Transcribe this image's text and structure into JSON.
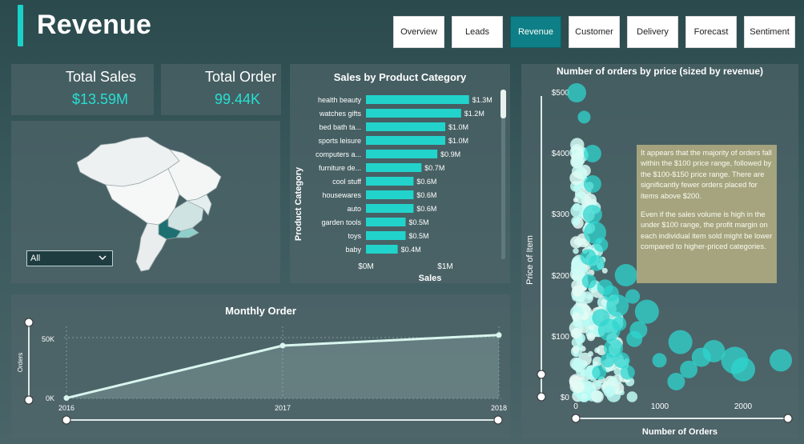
{
  "page": {
    "title": "Revenue"
  },
  "nav": [
    {
      "label": "Overview",
      "active": false
    },
    {
      "label": "Leads",
      "active": false
    },
    {
      "label": "Revenue",
      "active": true
    },
    {
      "label": "Customer",
      "active": false
    },
    {
      "label": "Delivery",
      "active": false
    },
    {
      "label": "Forecast",
      "active": false
    },
    {
      "label": "Sentiment",
      "active": false
    }
  ],
  "kpis": {
    "total_sales": {
      "label": "Total Sales",
      "value": "$13.59M"
    },
    "total_order": {
      "label": "Total Order",
      "value": "99.44K"
    }
  },
  "map": {
    "filter_value": "All"
  },
  "category_chart": {
    "title": "Sales by Product Category",
    "ylabel": "Product Category",
    "xlabel": "Sales",
    "xticks": [
      "$0M",
      "$1M"
    ]
  },
  "monthly_chart": {
    "title": "Monthly Order",
    "ylabel": "Orders",
    "yticks": [
      "50K",
      "0K"
    ],
    "xticks": [
      "2016",
      "2017",
      "2018"
    ]
  },
  "scatter_chart": {
    "title": "Number of orders by price (sized by revenue)",
    "ylabel": "Price of Item",
    "xlabel": "Number of Orders",
    "yticks": [
      "$500",
      "$400",
      "$300",
      "$200",
      "$100",
      "$0"
    ],
    "xticks": [
      "0",
      "1000",
      "2000"
    ],
    "note_p1": " It appears that the majority of orders fall within the $100 price range, followed by the $100-$150 price range. There are significantly fewer orders placed for items above $200.",
    "note_p2": "Even if the sales volume is high in the under $100 range, the profit margin on each individual item sold might be lower compared to higher-priced categories."
  },
  "colors": {
    "accent": "#19d2c7",
    "bar": "#22d3cc",
    "nav_active": "#0e7f86",
    "line": "#d9f5ee",
    "note_bg": "#b2ad82"
  },
  "chart_data": [
    {
      "type": "bar",
      "title": "Sales by Product Category",
      "xlabel": "Sales",
      "ylabel": "Product Category",
      "categories": [
        "health beauty",
        "watches gifts",
        "bed bath ta...",
        "sports leisure",
        "computers a...",
        "furniture de...",
        "cool stuff",
        "housewares",
        "auto",
        "garden tools",
        "toys",
        "baby"
      ],
      "values": [
        1.3,
        1.2,
        1.0,
        1.0,
        0.9,
        0.7,
        0.6,
        0.6,
        0.6,
        0.5,
        0.5,
        0.4
      ],
      "labels": [
        "$1.3M",
        "$1.2M",
        "$1.0M",
        "$1.0M",
        "$0.9M",
        "$0.7M",
        "$0.6M",
        "$0.6M",
        "$0.6M",
        "$0.5M",
        "$0.5M",
        "$0.4M"
      ],
      "xlim": [
        0,
        1.5
      ]
    },
    {
      "type": "line",
      "title": "Monthly Order",
      "ylabel": "Orders",
      "x": [
        "2016",
        "2017",
        "2018"
      ],
      "values": [
        300,
        45000,
        54000
      ],
      "ylim": [
        0,
        60000
      ]
    },
    {
      "type": "scatter",
      "title": "Number of orders by price (sized by revenue)",
      "xlabel": "Number of Orders",
      "ylabel": "Price of Item",
      "xlim": [
        0,
        2500
      ],
      "ylim": [
        0,
        500
      ],
      "points": [
        [
          1650,
          75,
          14
        ],
        [
          1900,
          60,
          17
        ],
        [
          2000,
          45,
          15
        ],
        [
          2450,
          60,
          14
        ],
        [
          1250,
          90,
          15
        ],
        [
          1500,
          65,
          12
        ],
        [
          1350,
          45,
          11
        ],
        [
          1200,
          25,
          11
        ],
        [
          850,
          140,
          15
        ],
        [
          600,
          200,
          14
        ],
        [
          500,
          150,
          14
        ],
        [
          400,
          110,
          14
        ],
        [
          200,
          400,
          11
        ],
        [
          200,
          350,
          11
        ],
        [
          200,
          300,
          12
        ],
        [
          230,
          270,
          14
        ],
        [
          150,
          230,
          10
        ],
        [
          10,
          500,
          12
        ],
        [
          450,
          80,
          12
        ],
        [
          550,
          60,
          10
        ],
        [
          350,
          180,
          10
        ],
        [
          300,
          130,
          11
        ],
        [
          700,
          95,
          10
        ],
        [
          750,
          110,
          11
        ],
        [
          300,
          250,
          9
        ],
        [
          250,
          220,
          10
        ],
        [
          420,
          170,
          10
        ],
        [
          380,
          60,
          9
        ],
        [
          620,
          40,
          9
        ],
        [
          100,
          460,
          8
        ],
        [
          1000,
          60,
          9
        ],
        [
          160,
          190,
          9
        ],
        [
          520,
          120,
          9
        ],
        [
          280,
          40,
          9
        ],
        [
          680,
          165,
          9
        ]
      ]
    }
  ]
}
